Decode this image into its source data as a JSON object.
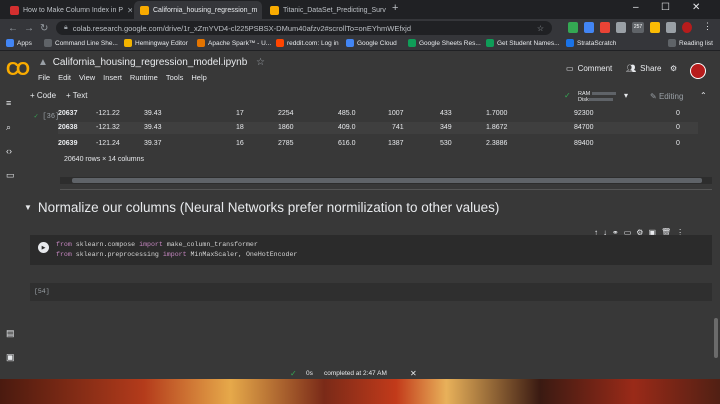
{
  "browser": {
    "tabs": [
      {
        "title": "How to Make Column Index in P",
        "color": "#d32f2f"
      },
      {
        "title": "California_housing_regression_m",
        "color": "#f9ab00"
      },
      {
        "title": "Titanic_DataSet_Predicting_Surv",
        "color": "#f9ab00"
      }
    ],
    "new_tab": "+",
    "url": "colab.research.google.com/drive/1r_xZmYVD4-cl225PSBSX-DMum40afzv2#scrollTo=onEYhmWEfxjd",
    "bookmarks": [
      {
        "label": "Apps",
        "color": "#4285f4"
      },
      {
        "label": "Command Line She...",
        "color": "#5f6368"
      },
      {
        "label": "Hemingway Editor",
        "color": "#f4b400"
      },
      {
        "label": "Apache Spark™ - U...",
        "color": "#e37400"
      },
      {
        "label": "reddit.com: Log in",
        "color": "#ff4500"
      },
      {
        "label": "Google Cloud",
        "color": "#4285f4"
      },
      {
        "label": "Google Sheets Res...",
        "color": "#0f9d58"
      },
      {
        "label": "Get Student Names...",
        "color": "#0f9d58"
      },
      {
        "label": "StrataScratch",
        "color": "#1a73e8"
      },
      {
        "label": "Reading list",
        "color": "#5f6368"
      }
    ],
    "ext_badge": "257"
  },
  "colab": {
    "logo": "CO",
    "title": "California_housing_regression_model.ipynb",
    "menu": [
      "File",
      "Edit",
      "View",
      "Insert",
      "Runtime",
      "Tools",
      "Help"
    ],
    "comment": "Comment",
    "share": "Share",
    "add_code": "+ Code",
    "add_text": "+ Text",
    "ram": "RAM",
    "disk": "Disk",
    "editing": "Editing"
  },
  "output_cell": {
    "run_count": "[36]",
    "rows": [
      [
        "20637",
        "-121.22",
        "39.43",
        "17",
        "2254",
        "485.0",
        "1007",
        "433",
        "1.7000",
        "92300",
        "0"
      ],
      [
        "20638",
        "-121.32",
        "39.43",
        "18",
        "1860",
        "409.0",
        "741",
        "349",
        "1.8672",
        "84700",
        "0"
      ],
      [
        "20639",
        "-121.24",
        "39.37",
        "16",
        "2785",
        "616.0",
        "1387",
        "530",
        "2.3886",
        "89400",
        "0"
      ]
    ],
    "shape_info": "20640 rows × 14 columns"
  },
  "section": {
    "heading": "Normalize our columns (Neural Networks prefer normilization to other values)"
  },
  "code_cell": {
    "line1": {
      "kw1": "from",
      "mod": " sklearn.compose ",
      "kw2": "import",
      "rest": " make_column_transformer"
    },
    "line2": {
      "kw1": "from",
      "mod": " sklearn.preprocessing ",
      "kw2": "import",
      "rest": " MinMaxScaler, OneHotEncoder"
    }
  },
  "empty_cell": {
    "run_count": "[54]"
  },
  "status": {
    "duration": "0s",
    "completed": "completed at 2:47 AM"
  }
}
